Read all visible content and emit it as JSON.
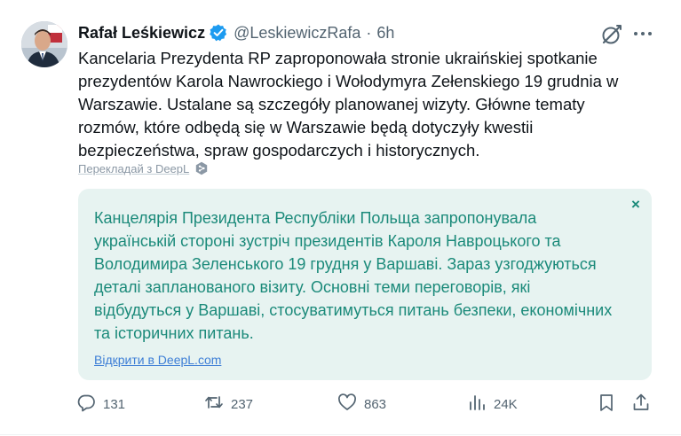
{
  "author": {
    "name": "Rafał Leśkiewicz",
    "handle": "@LeskiewiczRafa",
    "separator": "·",
    "time": "6h"
  },
  "tweet_text": "Kancelaria Prezydenta RP zaproponowała stronie ukraińskiej spotkanie\nprezydentów Karola Nawrockiego i Wołodymyra Zełenskiego 19 grudnia w\nWarszawie. Ustalane są szczegóły planowanej wizyty. Główne tematy\nrozmów, które odbędą się w Warszawie będą dotyczyły kwestii\nbezpieczeństwa, spraw gospodarczych i historycznych.",
  "translate_label": "Перекладай з DeepL",
  "translation": {
    "text": "Канцелярія Президента Республіки Польща запропонувала\nукраїнській стороні зустріч президентів Кароля Навроцького та\nВолодимира Зеленського 19 грудня у Варшаві. Зараз узгоджуються\nдеталі запланованого візиту. Основні теми переговорів, які\nвідбудуться у Варшаві, стосуватимуться питань безпеки, економічних\nта історичних питань.",
    "close_glyph": "×",
    "open_link": "Відкрити в DeepL.com"
  },
  "actions": {
    "replies": "131",
    "reposts": "237",
    "likes": "863",
    "views": "24K"
  },
  "colors": {
    "verified": "#1d9bf0",
    "translation_text": "#1b8a7a",
    "translation_bg": "#e7f3f1",
    "link": "#3d7ed6",
    "muted": "#536471"
  },
  "icons": [
    "verified-badge-icon",
    "grok-icon",
    "more-icon",
    "deepl-icon",
    "close-icon",
    "reply-icon",
    "repost-icon",
    "like-icon",
    "views-icon",
    "bookmark-icon",
    "share-icon"
  ]
}
